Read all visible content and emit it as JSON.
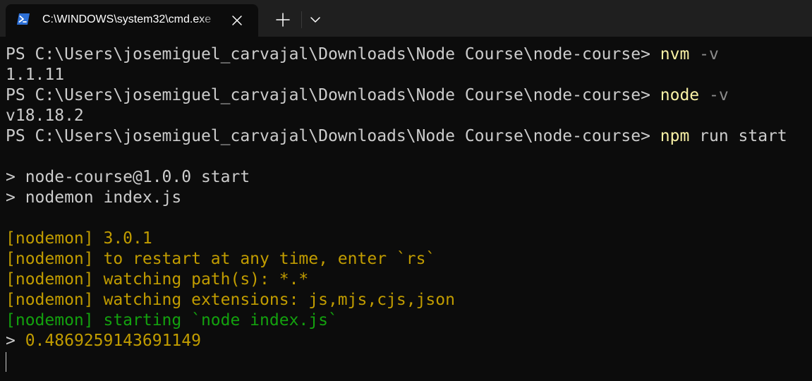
{
  "tab": {
    "title": "C:\\WINDOWS\\system32\\cmd.exe",
    "icon": "powershell-icon",
    "close_icon": "close-icon"
  },
  "titlebar": {
    "new_tab_icon": "plus-icon",
    "dropdown_icon": "chevron-down-icon"
  },
  "colors": {
    "background": "#0c0c0c",
    "titlebar": "#1f1f1f",
    "default_text": "#cccccc",
    "command": "#f9f1a5",
    "parameter": "#8c8c8c",
    "nodemon": "#c19c00",
    "nodemon_start": "#13a10e"
  },
  "terminal": {
    "lines": [
      {
        "prompt": "PS C:\\Users\\josemiguel_carvajal\\Downloads\\Node Course\\node-course> ",
        "command": "nvm",
        "args": " -v"
      },
      {
        "text": "1.1.11"
      },
      {
        "prompt": "PS C:\\Users\\josemiguel_carvajal\\Downloads\\Node Course\\node-course> ",
        "command": "node",
        "args": " -v"
      },
      {
        "text": "v18.18.2"
      },
      {
        "prompt": "PS C:\\Users\\josemiguel_carvajal\\Downloads\\Node Course\\node-course> ",
        "command": "npm",
        "args": " run start"
      },
      {
        "text": "> node-course@1.0.0 start"
      },
      {
        "text": "> nodemon index.js"
      },
      {
        "text": "[nodemon] 3.0.1"
      },
      {
        "text": "[nodemon] to restart at any time, enter `rs`"
      },
      {
        "text": "[nodemon] watching path(s): *.*"
      },
      {
        "text": "[nodemon] watching extensions: js,mjs,cjs,json"
      },
      {
        "text": "[nodemon] starting `node index.js`"
      },
      {
        "prefix": "> ",
        "text": "0.4869259143691149"
      }
    ]
  }
}
